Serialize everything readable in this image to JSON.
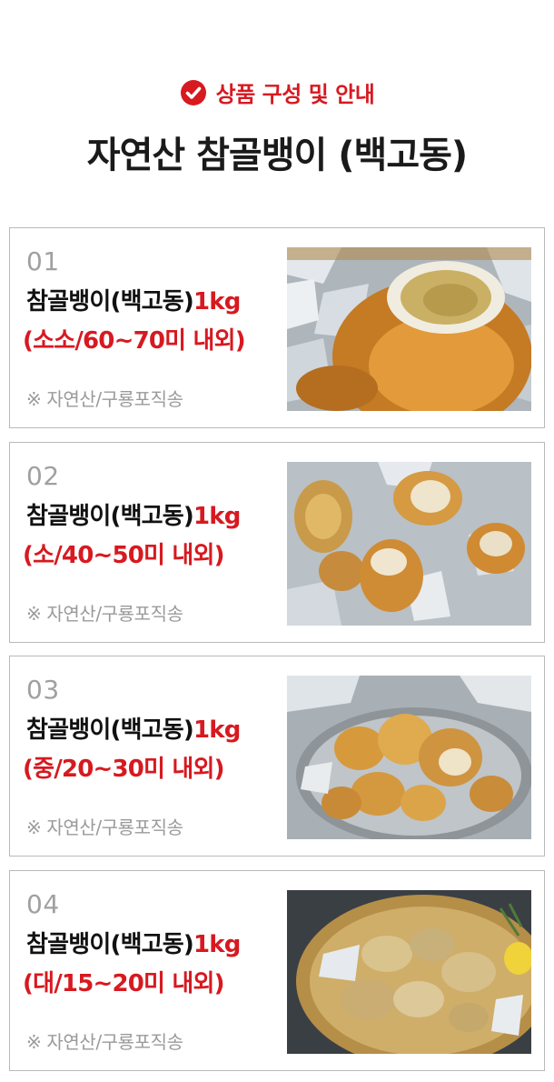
{
  "header": {
    "section_label": "상품 구성 및 안내",
    "title": "자연산 참골뱅이 (백고동)",
    "accent_color": "#d71920",
    "icon": "check-circle-icon"
  },
  "products": [
    {
      "number": "01",
      "name": "참골뱅이(백고동)",
      "weight": "1kg",
      "size": "(소소/60~70미 내외)",
      "note": "※ 자연산/구룡포직송",
      "photo": "whelks-on-ice-photo"
    },
    {
      "number": "02",
      "name": "참골뱅이(백고동)",
      "weight": "1kg",
      "size": "(소/40~50미 내외)",
      "note": "※ 자연산/구룡포직송",
      "photo": "whelks-on-ice-photo"
    },
    {
      "number": "03",
      "name": "참골뱅이(백고동)",
      "weight": "1kg",
      "size": "(중/20~30미 내외)",
      "note": "※ 자연산/구룡포직송",
      "photo": "whelks-in-bowl-photo"
    },
    {
      "number": "04",
      "name": "참골뱅이(백고동)",
      "weight": "1kg",
      "size": "(대/15~20미 내외)",
      "note": "※ 자연산/구룡포직송",
      "photo": "whelks-on-basket-photo"
    }
  ]
}
